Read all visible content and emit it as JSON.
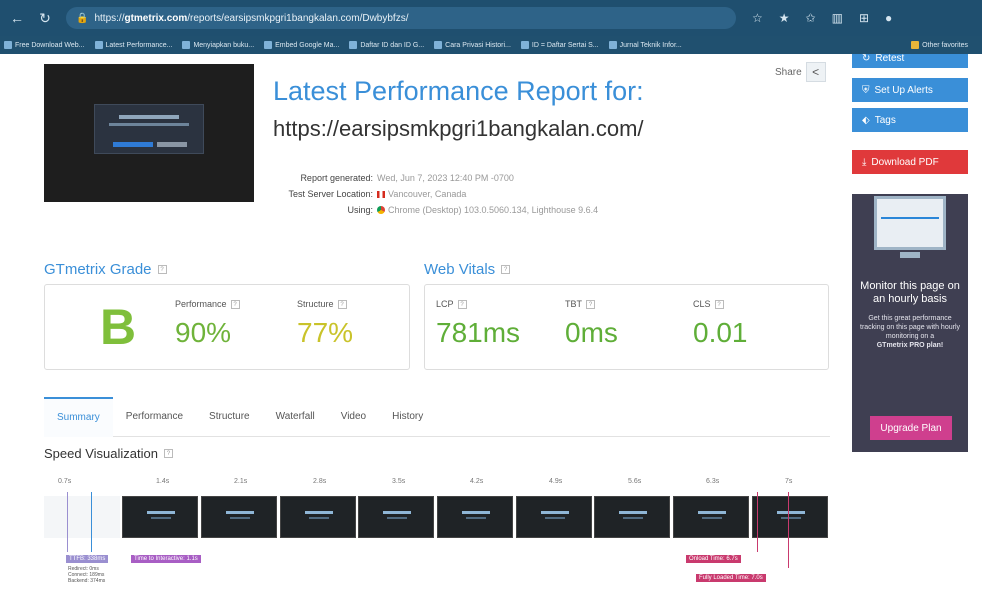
{
  "browser": {
    "url_prefix": "https://",
    "url_host": "gtmetrix.com",
    "url_path": "/reports/earsipsmkpgri1bangkalan.com/Dwbybfzs/",
    "bookmarks": [
      "Free Download Web...",
      "Latest Performance...",
      "Menyiapkan buku...",
      "Embed Google Ma...",
      "Daftar ID dan ID G...",
      "Cara Privasi Histori...",
      "ID = Daftar Sertai S...",
      "Jurnal Teknik Infor..."
    ],
    "other_favorites": "Other favorites"
  },
  "report": {
    "share_label": "Share",
    "title": "Latest Performance Report for:",
    "url": "https://earsipsmkpgri1bangkalan.com/",
    "meta": [
      {
        "label": "Report generated:",
        "value": "Wed, Jun 7, 2023 12:40 PM -0700"
      },
      {
        "label": "Test Server Location:",
        "value": "Vancouver, Canada"
      },
      {
        "label": "Using:",
        "value": "Chrome (Desktop) 103.0.5060.134, Lighthouse 9.6.4"
      }
    ]
  },
  "grade": {
    "heading": "GTmetrix Grade",
    "letter": "B",
    "performance_label": "Performance",
    "performance_value": "90%",
    "structure_label": "Structure",
    "structure_value": "77%",
    "colors": {
      "letter": "#7fbf3b",
      "performance": "#6fb33a",
      "structure": "#c9c32a"
    }
  },
  "vitals": {
    "heading": "Web Vitals",
    "lcp_label": "LCP",
    "lcp_value": "781ms",
    "tbt_label": "TBT",
    "tbt_value": "0ms",
    "cls_label": "CLS",
    "cls_value": "0.01",
    "color": "#5fae38"
  },
  "tabs": [
    "Summary",
    "Performance",
    "Structure",
    "Waterfall",
    "Video",
    "History"
  ],
  "speed": {
    "heading": "Speed Visualization",
    "ticks": [
      "0.7s",
      "1.4s",
      "2.1s",
      "2.8s",
      "3.5s",
      "4.2s",
      "4.9s",
      "5.6s",
      "6.3s",
      "7s"
    ],
    "markers": {
      "ttfb": "TTFB: 338ms",
      "tti": "Time to Interactive: 1.1s",
      "onload": "Onload Time: 6.7s",
      "fully_loaded": "Fully Loaded Time: 7.0s"
    },
    "sub": [
      "Redirect: 0ms",
      "Connect: 189ms",
      "Backend: 374ms"
    ]
  },
  "sidebar": {
    "top_button": "Retest",
    "alerts": "Set Up Alerts",
    "tags": "Tags",
    "download": "Download PDF",
    "promo_heading": "Monitor this page on an hourly basis",
    "promo_text_1": "Get this great performance tracking on this page with hourly monitoring on a",
    "promo_text_2": "GTmetrix PRO plan!",
    "upgrade": "Upgrade Plan"
  }
}
